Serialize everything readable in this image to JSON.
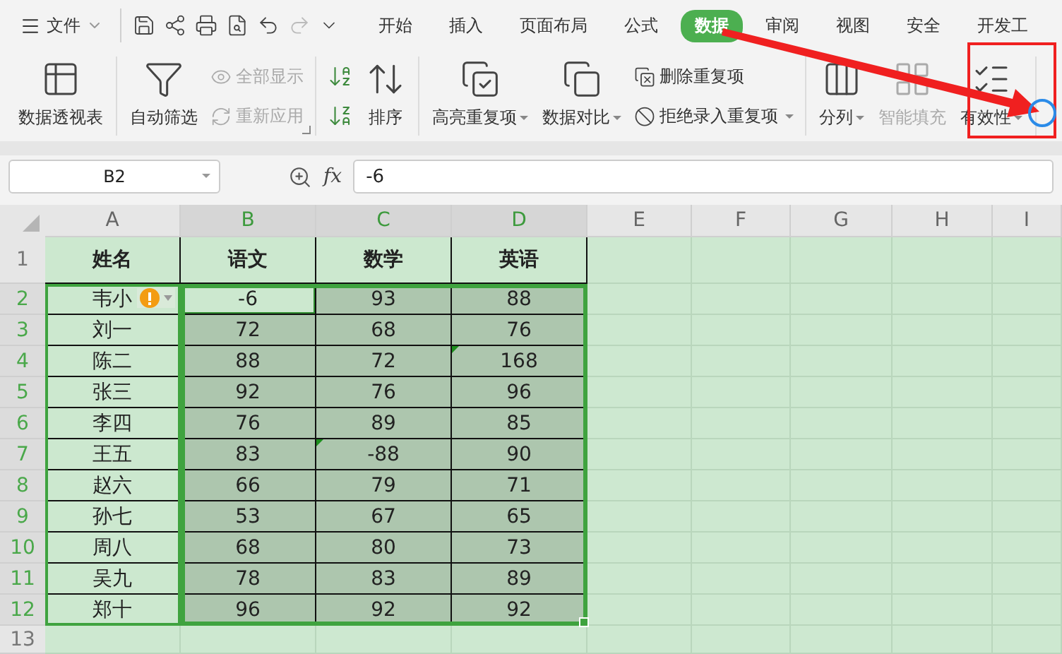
{
  "menu_bar": {
    "file_menu": "文件",
    "tabs": [
      {
        "label": "开始",
        "selected": false
      },
      {
        "label": "插入",
        "selected": false
      },
      {
        "label": "页面布局",
        "selected": false
      },
      {
        "label": "公式",
        "selected": false
      },
      {
        "label": "数据",
        "selected": true
      },
      {
        "label": "审阅",
        "selected": false
      },
      {
        "label": "视图",
        "selected": false
      },
      {
        "label": "安全",
        "selected": false
      },
      {
        "label": "开发工",
        "selected": false
      }
    ]
  },
  "ribbon": {
    "groups": [
      {
        "items": [
          {
            "kind": "large",
            "label": "数据透视表",
            "disabled": false,
            "dropdown": false
          }
        ]
      },
      {
        "items": [
          {
            "kind": "large",
            "label": "自动筛选",
            "disabled": false,
            "dropdown": false
          },
          {
            "kind": "small",
            "label": "全部显示",
            "disabled": true,
            "dropdown": false
          },
          {
            "kind": "small",
            "label": "重新应用",
            "disabled": true,
            "dropdown": false
          },
          {
            "kind": "launcher"
          }
        ]
      },
      {
        "items": [
          {
            "kind": "icons"
          },
          {
            "kind": "large",
            "label": "排序",
            "disabled": false,
            "dropdown": false
          }
        ]
      },
      {
        "items": [
          {
            "kind": "large",
            "label": "高亮重复项",
            "disabled": false,
            "dropdown": true
          },
          {
            "kind": "large",
            "label": "数据对比",
            "disabled": false,
            "dropdown": true
          },
          {
            "kind": "small",
            "label": "删除重复项",
            "disabled": false,
            "dropdown": false
          },
          {
            "kind": "small",
            "label": "拒绝录入重复项",
            "disabled": false,
            "dropdown": true
          }
        ]
      },
      {
        "items": [
          {
            "kind": "large",
            "label": "分列",
            "disabled": false,
            "dropdown": true
          },
          {
            "kind": "large",
            "label": "智能填充",
            "disabled": true,
            "dropdown": false
          },
          {
            "kind": "large",
            "label": "有效性",
            "disabled": false,
            "dropdown": true
          }
        ]
      }
    ]
  },
  "formula_bar": {
    "name_box": "B2",
    "fx": "fx",
    "value": "-6"
  },
  "sheet": {
    "columns": [
      {
        "label": "A",
        "selected": false
      },
      {
        "label": "B",
        "selected": true
      },
      {
        "label": "C",
        "selected": true
      },
      {
        "label": "D",
        "selected": true
      },
      {
        "label": "E",
        "selected": false
      },
      {
        "label": "F",
        "selected": false
      },
      {
        "label": "G",
        "selected": false
      },
      {
        "label": "H",
        "selected": false
      },
      {
        "label": "I",
        "selected": false
      }
    ],
    "header_row": {
      "number": "1",
      "selected": false,
      "cells": [
        "姓名",
        "语文",
        "数学",
        "英语"
      ]
    },
    "rows": [
      {
        "number": "2",
        "selected": true,
        "cells": [
          {
            "text": "韦小",
            "active": false,
            "flagged": false,
            "warning": true
          },
          {
            "text": "-6",
            "active": true,
            "flagged": false,
            "warning": false
          },
          {
            "text": "93",
            "active": false,
            "flagged": false,
            "warning": false
          },
          {
            "text": "88",
            "active": false,
            "flagged": false,
            "warning": false
          }
        ]
      },
      {
        "number": "3",
        "selected": true,
        "cells": [
          {
            "text": "刘一",
            "active": false,
            "flagged": false,
            "warning": false
          },
          {
            "text": "72",
            "active": false,
            "flagged": false,
            "warning": false
          },
          {
            "text": "68",
            "active": false,
            "flagged": false,
            "warning": false
          },
          {
            "text": "76",
            "active": false,
            "flagged": false,
            "warning": false
          }
        ]
      },
      {
        "number": "4",
        "selected": true,
        "cells": [
          {
            "text": "陈二",
            "active": false,
            "flagged": false,
            "warning": false
          },
          {
            "text": "88",
            "active": false,
            "flagged": false,
            "warning": false
          },
          {
            "text": "72",
            "active": false,
            "flagged": false,
            "warning": false
          },
          {
            "text": "168",
            "active": false,
            "flagged": true,
            "warning": false
          }
        ]
      },
      {
        "number": "5",
        "selected": true,
        "cells": [
          {
            "text": "张三",
            "active": false,
            "flagged": false,
            "warning": false
          },
          {
            "text": "92",
            "active": false,
            "flagged": false,
            "warning": false
          },
          {
            "text": "76",
            "active": false,
            "flagged": false,
            "warning": false
          },
          {
            "text": "96",
            "active": false,
            "flagged": false,
            "warning": false
          }
        ]
      },
      {
        "number": "6",
        "selected": true,
        "cells": [
          {
            "text": "李四",
            "active": false,
            "flagged": false,
            "warning": false
          },
          {
            "text": "76",
            "active": false,
            "flagged": false,
            "warning": false
          },
          {
            "text": "89",
            "active": false,
            "flagged": false,
            "warning": false
          },
          {
            "text": "85",
            "active": false,
            "flagged": false,
            "warning": false
          }
        ]
      },
      {
        "number": "7",
        "selected": true,
        "cells": [
          {
            "text": "王五",
            "active": false,
            "flagged": false,
            "warning": false
          },
          {
            "text": "83",
            "active": false,
            "flagged": false,
            "warning": false
          },
          {
            "text": "-88",
            "active": false,
            "flagged": true,
            "warning": false
          },
          {
            "text": "90",
            "active": false,
            "flagged": false,
            "warning": false
          }
        ]
      },
      {
        "number": "8",
        "selected": true,
        "cells": [
          {
            "text": "赵六",
            "active": false,
            "flagged": false,
            "warning": false
          },
          {
            "text": "66",
            "active": false,
            "flagged": false,
            "warning": false
          },
          {
            "text": "79",
            "active": false,
            "flagged": false,
            "warning": false
          },
          {
            "text": "71",
            "active": false,
            "flagged": false,
            "warning": false
          }
        ]
      },
      {
        "number": "9",
        "selected": true,
        "cells": [
          {
            "text": "孙七",
            "active": false,
            "flagged": false,
            "warning": false
          },
          {
            "text": "53",
            "active": false,
            "flagged": false,
            "warning": false
          },
          {
            "text": "67",
            "active": false,
            "flagged": false,
            "warning": false
          },
          {
            "text": "65",
            "active": false,
            "flagged": false,
            "warning": false
          }
        ]
      },
      {
        "number": "10",
        "selected": true,
        "cells": [
          {
            "text": "周八",
            "active": false,
            "flagged": false,
            "warning": false
          },
          {
            "text": "68",
            "active": false,
            "flagged": false,
            "warning": false
          },
          {
            "text": "80",
            "active": false,
            "flagged": false,
            "warning": false
          },
          {
            "text": "73",
            "active": false,
            "flagged": false,
            "warning": false
          }
        ]
      },
      {
        "number": "11",
        "selected": true,
        "cells": [
          {
            "text": "吴九",
            "active": false,
            "flagged": false,
            "warning": false
          },
          {
            "text": "78",
            "active": false,
            "flagged": false,
            "warning": false
          },
          {
            "text": "83",
            "active": false,
            "flagged": false,
            "warning": false
          },
          {
            "text": "89",
            "active": false,
            "flagged": false,
            "warning": false
          }
        ]
      },
      {
        "number": "12",
        "selected": true,
        "cells": [
          {
            "text": "郑十",
            "active": false,
            "flagged": false,
            "warning": false
          },
          {
            "text": "96",
            "active": false,
            "flagged": false,
            "warning": false
          },
          {
            "text": "92",
            "active": false,
            "flagged": false,
            "warning": false
          },
          {
            "text": "92",
            "active": false,
            "flagged": false,
            "warning": false
          }
        ]
      },
      {
        "number": "13",
        "selected": false,
        "cells": []
      }
    ]
  }
}
